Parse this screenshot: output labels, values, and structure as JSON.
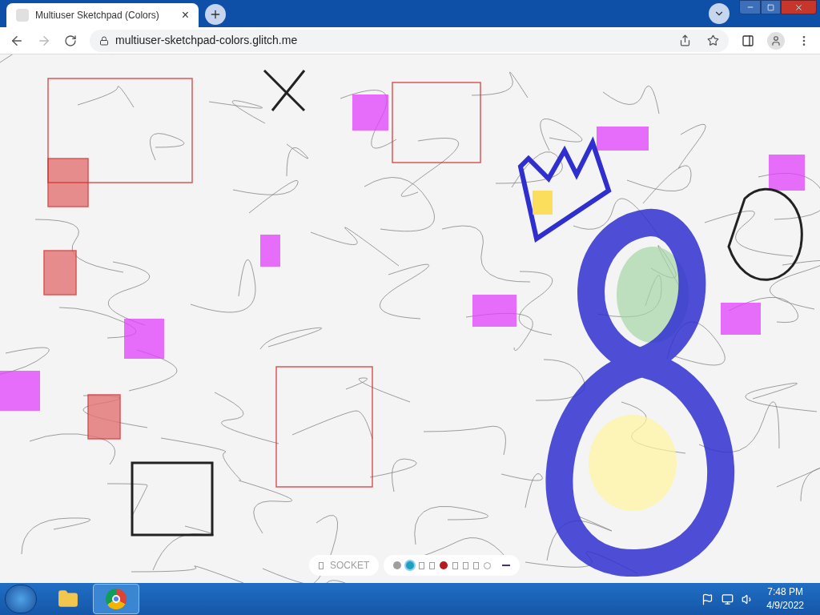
{
  "browser": {
    "tab_title": "Multiuser Sketchpad (Colors)",
    "tab_close": "×",
    "url": "multiuser-sketchpad-colors.glitch.me"
  },
  "toolbar": {
    "socket_label": "SOCKET",
    "swatches": [
      {
        "kind": "dot",
        "color": "#9e9e9e",
        "selected": false
      },
      {
        "kind": "dot",
        "color": "#1aa3b8",
        "selected": true
      },
      {
        "kind": "box",
        "selected": false
      },
      {
        "kind": "box",
        "selected": false
      },
      {
        "kind": "dot",
        "color": "#b71c1c",
        "selected": false
      },
      {
        "kind": "box",
        "selected": false
      },
      {
        "kind": "box",
        "selected": false
      },
      {
        "kind": "box",
        "selected": false
      },
      {
        "kind": "ring",
        "selected": false
      },
      {
        "kind": "line",
        "color": "#4a2c86",
        "selected": false
      }
    ]
  },
  "taskbar": {
    "time": "7:48 PM",
    "date": "4/9/2022"
  }
}
